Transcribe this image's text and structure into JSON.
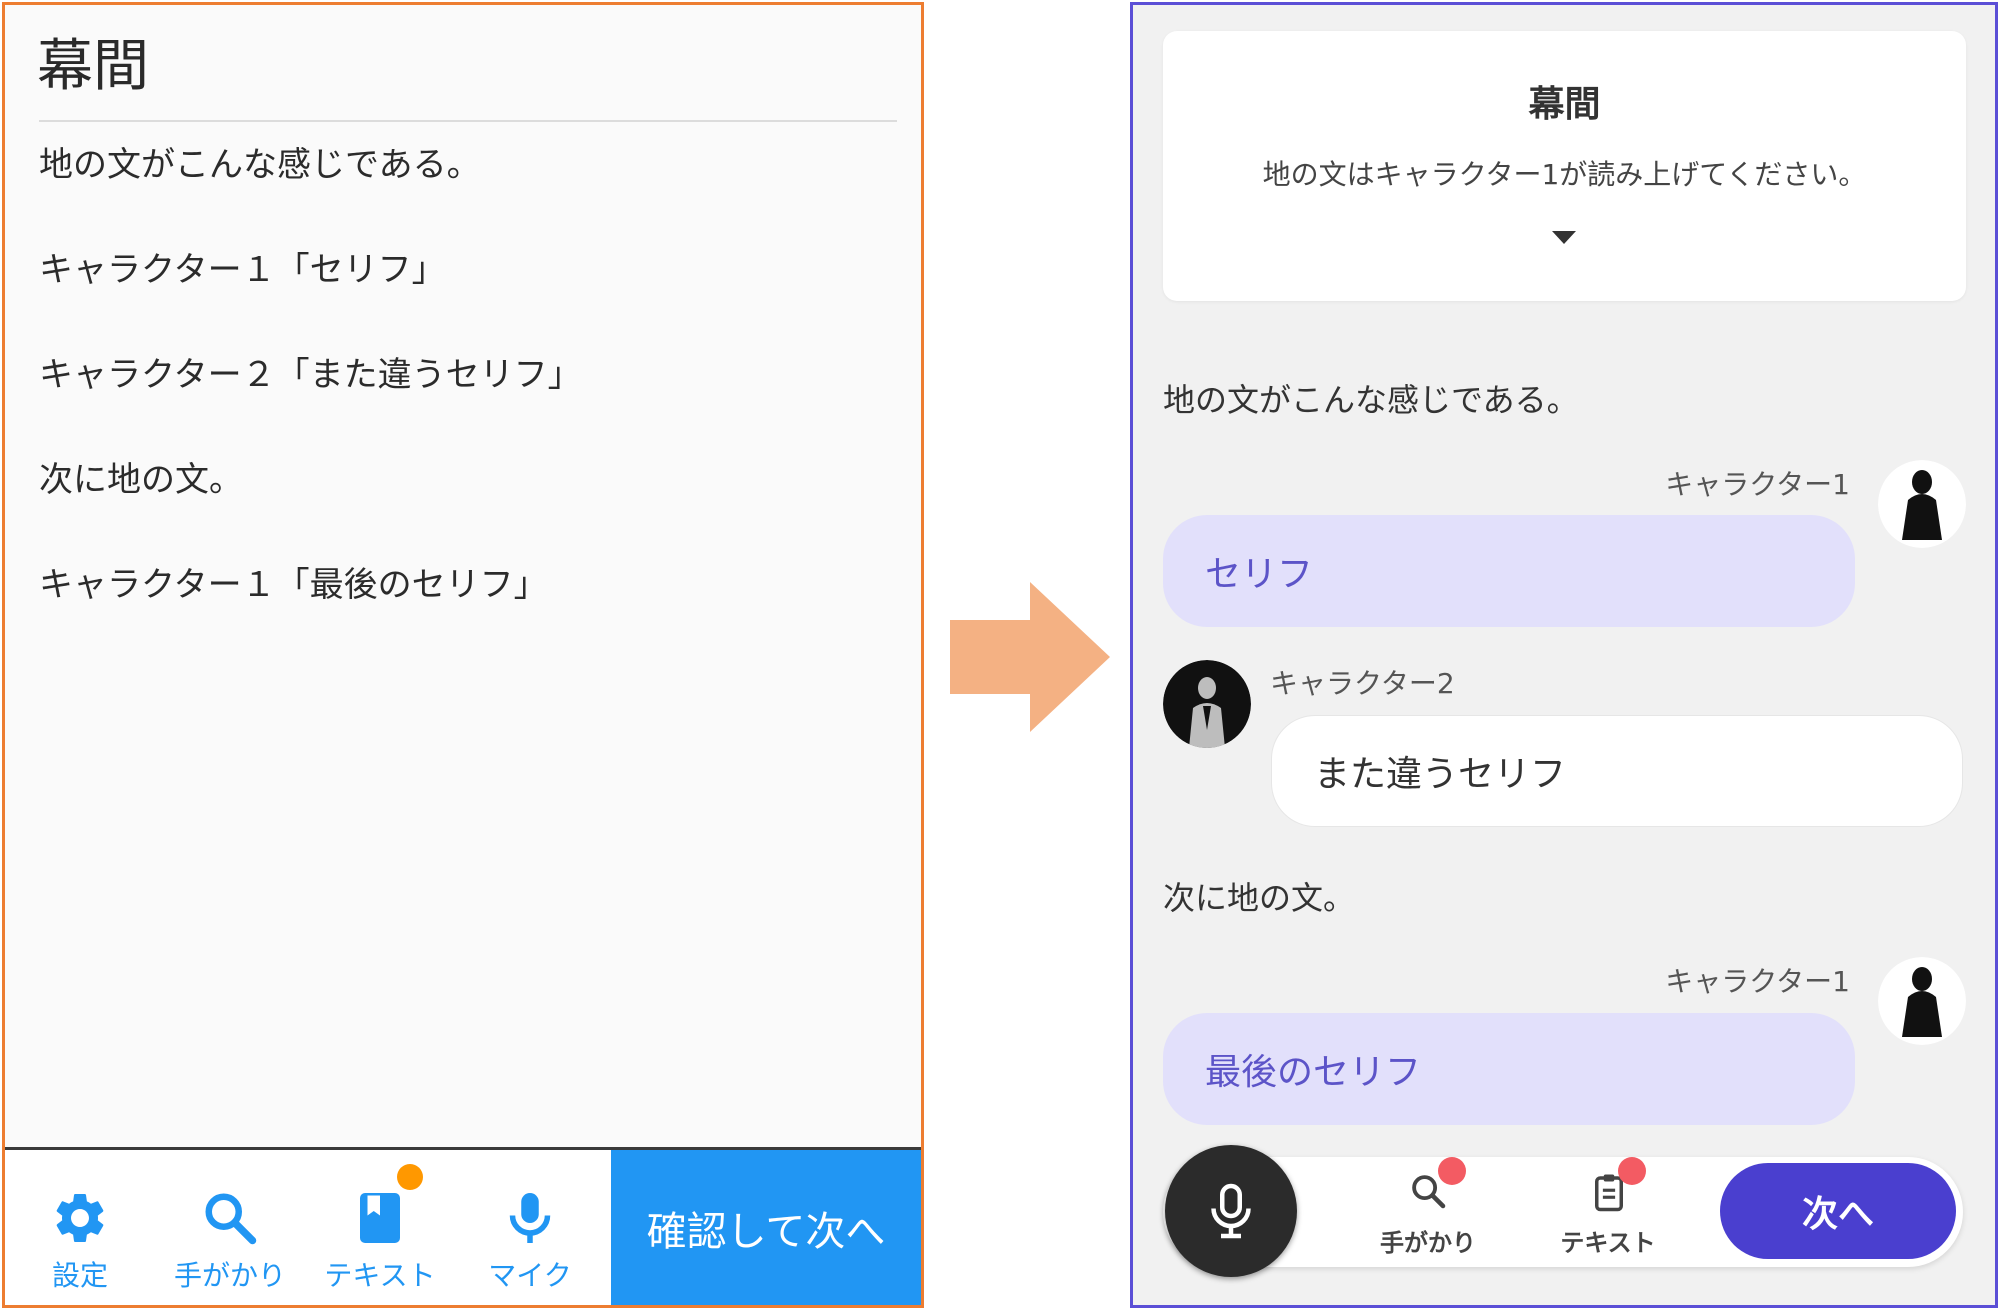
{
  "before": {
    "title": "幕間",
    "lines": [
      "地の文がこんな感じである。",
      "キャラクター１「セリフ」",
      "キャラクター２「また違うセリフ」",
      "次に地の文。",
      "キャラクター１「最後のセリフ」"
    ],
    "toolbar": {
      "items": [
        {
          "label": "設定",
          "icon": "gear-icon"
        },
        {
          "label": "手がかり",
          "icon": "search-icon"
        },
        {
          "label": "テキスト",
          "icon": "book-icon",
          "badge": true
        },
        {
          "label": "マイク",
          "icon": "mic-icon"
        }
      ],
      "confirm_label": "確認して次へ",
      "accent_color": "#2196f3",
      "badge_color": "#ff9800"
    }
  },
  "after": {
    "header": {
      "title": "幕間",
      "note": "地の文はキャラクター1が読み上げてください。"
    },
    "messages": [
      {
        "type": "narration",
        "text": "地の文がこんな感じである。"
      },
      {
        "type": "speech",
        "speaker": "キャラクター1",
        "text": "セリフ",
        "side": "right"
      },
      {
        "type": "speech",
        "speaker": "キャラクター2",
        "text": "また違うセリフ",
        "side": "left"
      },
      {
        "type": "narration",
        "text": "次に地の文。"
      },
      {
        "type": "speech",
        "speaker": "キャラクター1",
        "text": "最後のセリフ",
        "side": "right"
      }
    ],
    "bottom_bar": {
      "mic_icon": "mic-icon",
      "clue_label": "手がかり",
      "text_label": "テキスト",
      "next_label": "次へ",
      "accent_color": "#4a3fcf",
      "badge_color": "#f35b63"
    }
  },
  "colors": {
    "before_border": "#ed7d31",
    "after_border": "#5b4fd6",
    "arrow": "#f4b183"
  }
}
